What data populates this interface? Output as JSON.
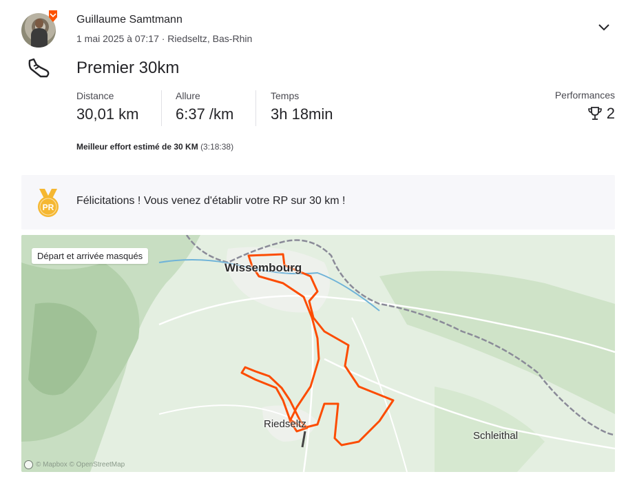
{
  "athlete": {
    "name": "Guillaume Samtmann",
    "meta": "1 mai 2025 à 07:17 · Riedseltz, Bas-Rhin"
  },
  "activity": {
    "title": "Premier 30km",
    "sport_icon": "running-shoe-icon"
  },
  "stats": [
    {
      "label": "Distance",
      "value": "30,01 km"
    },
    {
      "label": "Allure",
      "value": "6:37 /km"
    },
    {
      "label": "Temps",
      "value": "3h 18min"
    }
  ],
  "performances": {
    "label": "Performances",
    "count": "2",
    "icon": "trophy-icon"
  },
  "best_effort": {
    "label": "Meilleur effort estimé de 30 KM",
    "time": "(3:18:38)"
  },
  "pr_banner": {
    "icon_text": "PR",
    "message": "Félicitations ! Vous venez d'établir votre RP sur 30 km !"
  },
  "map": {
    "privacy_tag": "Départ et arrivée masqués",
    "cities": [
      "Wissembourg",
      "Riedseltz",
      "Schleithal"
    ],
    "attribution": "© Mapbox © OpenStreetMap"
  },
  "colors": {
    "brand": "#fc5200",
    "route": "#fc4c02",
    "medal": "#f5b731",
    "map_bg": "#e4efe1"
  }
}
